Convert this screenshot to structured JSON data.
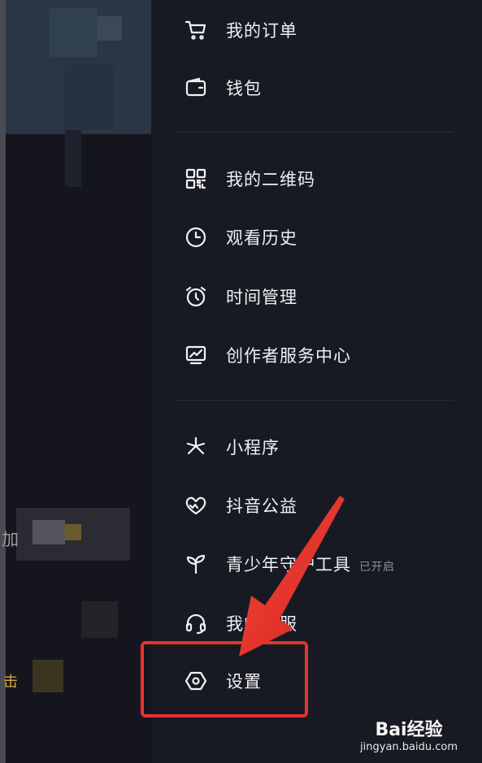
{
  "menu": {
    "items": [
      {
        "key": "orders",
        "label": "我的订单",
        "icon": "cart-icon"
      },
      {
        "key": "wallet",
        "label": "钱包",
        "icon": "wallet-icon"
      },
      {
        "key": "qrcode",
        "label": "我的二维码",
        "icon": "qrcode-icon"
      },
      {
        "key": "history",
        "label": "观看历史",
        "icon": "clock-icon"
      },
      {
        "key": "time",
        "label": "时间管理",
        "icon": "alarm-clock-icon"
      },
      {
        "key": "creator",
        "label": "创作者服务中心",
        "icon": "monitor-chart-icon"
      },
      {
        "key": "miniapp",
        "label": "小程序",
        "icon": "miniapp-star-icon"
      },
      {
        "key": "charity",
        "label": "抖音公益",
        "icon": "heart-hands-icon"
      },
      {
        "key": "youth",
        "label": "青少年守护工具",
        "badge": "已开启",
        "icon": "sprout-icon"
      },
      {
        "key": "service",
        "label": "我的客服",
        "icon": "headset-icon"
      },
      {
        "key": "settings",
        "label": "设置",
        "icon": "settings-hexagon-icon"
      }
    ]
  },
  "left_pane": {
    "partial_text_1": "加",
    "partial_text_2": "击"
  },
  "watermark": {
    "logo": "Bai经验",
    "url": "jingyan.baidu.com"
  },
  "colors": {
    "background": "#181a23",
    "highlight": "#e8322f",
    "text": "#f0f0f2"
  }
}
